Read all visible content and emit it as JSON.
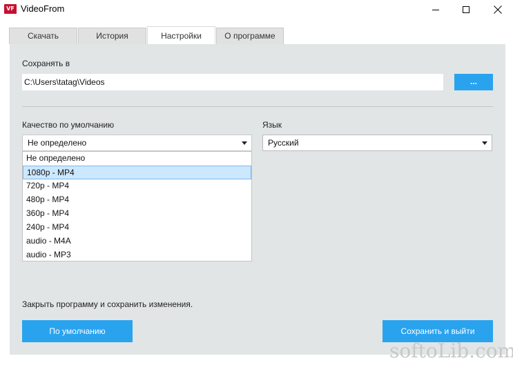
{
  "window": {
    "title": "VideoFrom",
    "icon_text": "VF"
  },
  "tabs": [
    {
      "label": "Скачать",
      "active": false
    },
    {
      "label": "История",
      "active": false
    },
    {
      "label": "Настройки",
      "active": true
    },
    {
      "label": "О программе",
      "active": false
    }
  ],
  "settings": {
    "save_label": "Сохранять в",
    "save_path": "C:\\Users\\tatag\\Videos",
    "browse_label": "...",
    "quality_label": "Качество по умолчанию",
    "quality_value": "Не определено",
    "language_label": "Язык",
    "language_value": "Русский",
    "quality_options": [
      {
        "label": "Не определено",
        "selected": false
      },
      {
        "label": "1080p - MP4",
        "selected": true
      },
      {
        "label": "720p - MP4",
        "selected": false
      },
      {
        "label": "480p - MP4",
        "selected": false
      },
      {
        "label": "360p - MP4",
        "selected": false
      },
      {
        "label": "240p - MP4",
        "selected": false
      },
      {
        "label": "audio - M4A",
        "selected": false
      },
      {
        "label": "audio - MP3",
        "selected": false
      }
    ],
    "note": "Закрыть программу и сохранить изменения.",
    "default_button": "По умолчанию",
    "save_button": "Сохранить и выйти"
  },
  "watermark": "softoLib.com",
  "colors": {
    "accent": "#2aa3ef",
    "panel": "#e1e5e6",
    "selection": "#cce8ff",
    "app_icon": "#c8102e"
  }
}
